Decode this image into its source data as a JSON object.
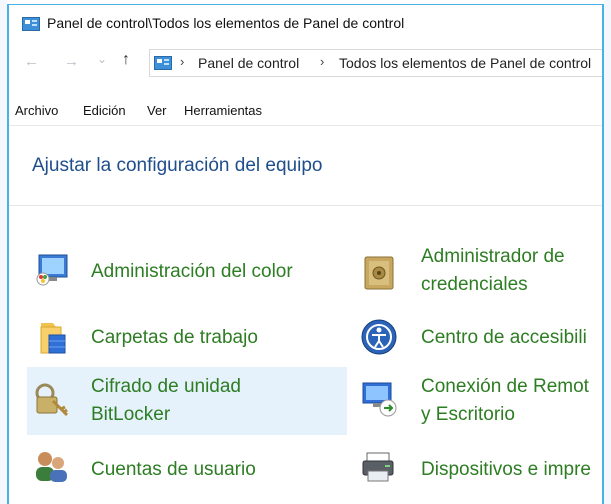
{
  "window": {
    "title": "Panel de control\\Todos los elementos de Panel de control"
  },
  "nav": {
    "back": "←",
    "forward": "→",
    "recent": "⌄",
    "up": "↑",
    "separator": "›",
    "breadcrumbs": [
      "Panel de control",
      "Todos los elementos de Panel de control"
    ]
  },
  "menu": [
    "Archivo",
    "Edición",
    "Ver",
    "Herramientas"
  ],
  "heading": "Ajustar la configuración del equipo",
  "items": {
    "left": [
      {
        "line1": "Administración del color",
        "line2": ""
      },
      {
        "line1": "Carpetas de trabajo",
        "line2": ""
      },
      {
        "line1": "Cifrado de unidad",
        "line2": "BitLocker",
        "highlighted": true
      },
      {
        "line1": "Cuentas de usuario",
        "line2": ""
      }
    ],
    "right": [
      {
        "line1": "Administrador de",
        "line2": "credenciales"
      },
      {
        "line1": "Centro de accesibili",
        "line2": ""
      },
      {
        "line1": "Conexión de Remot",
        "line2": "y Escritorio"
      },
      {
        "line1": "Dispositivos e impre",
        "line2": ""
      }
    ]
  },
  "colors": {
    "link_green": "#2d7d23",
    "heading_blue": "#1e4e8c",
    "window_border": "#48b2e6",
    "highlight": "#e5f1fb"
  }
}
